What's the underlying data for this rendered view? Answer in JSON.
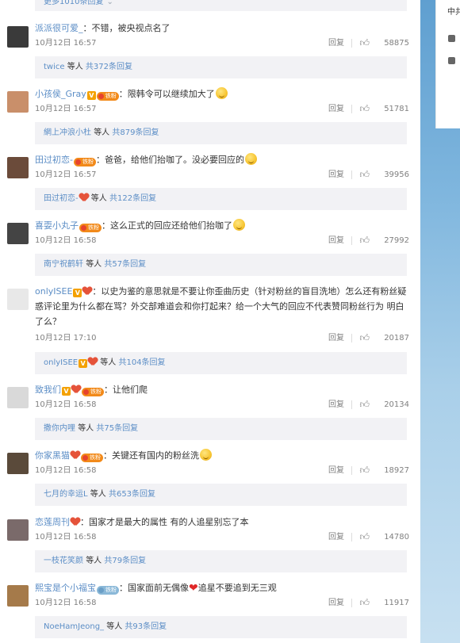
{
  "more_replies": "更多1010条回复",
  "right_panel": {
    "label": "中共"
  },
  "reply_label": "回复",
  "by_suffix": "等人",
  "comments": [
    {
      "user": "派派很可爱_",
      "text": "：不错，被央视点名了",
      "time": "10月12日 16:57",
      "likes": "58875",
      "sub_user": "twice",
      "sub_count": "共372条回复",
      "avatar": "#3a3a3a"
    },
    {
      "user": "小孩侯_Gray",
      "text": "：限韩令可以继续加大了",
      "time": "10月12日 16:57",
      "likes": "51781",
      "sub_user": "網上冲浪小杜",
      "sub_count": "共879条回复",
      "avatar": "#c98f6a"
    },
    {
      "user": "田过初恋-",
      "text": "：爸爸，给他们抬咖了。没必要回应的",
      "time": "10月12日 16:57",
      "likes": "39956",
      "sub_user": "田过初恋-",
      "sub_count": "共122条回复",
      "avatar": "#6b4b3a"
    },
    {
      "user": "喜耍小丸子",
      "text": "：这么正式的回应还给他们抬咖了",
      "time": "10月12日 16:58",
      "likes": "27992",
      "sub_user": "南宁祝鹤轩",
      "sub_count": "共57条回复",
      "avatar": "#444444"
    },
    {
      "user": "onlyISEE",
      "text": "：以史为鉴的意思就是不要让你歪曲历史（针对粉丝的盲目洗地）怎么还有粉丝疑惑评论里为什么都在骂？外交部难道会和你打起来？给一个大气的回应不代表赞同粉丝行为 明白了么？",
      "time": "10月12日 17:10",
      "likes": "20187",
      "sub_user": "onlyISEE",
      "sub_count": "共104条回复",
      "avatar": "#bbbbbb"
    },
    {
      "user": "致我们",
      "text": "：让他们爬",
      "time": "10月12日 16:58",
      "likes": "20134",
      "sub_user": "撒你内哩",
      "sub_count": "共75条回复",
      "avatar": "#d9d9d9"
    },
    {
      "user": "你家黑猫",
      "text": "：关键还有国内的粉丝洗",
      "time": "10月12日 16:58",
      "likes": "18927",
      "sub_user": "七月的幸运L",
      "sub_count": "共653条回复",
      "avatar": "#5a4a3a"
    },
    {
      "user": "恋莲周刊",
      "text": "：国家才是最大的属性 有的人追星别忘了本",
      "time": "10月12日 16:58",
      "likes": "14780",
      "sub_user": "一枝花笑颜",
      "sub_count": "共79条回复",
      "avatar": "#7a6a6a"
    },
    {
      "user": "熙宝是个小福宝",
      "text": "：国家面前无偶像",
      "text2": "追星不要追到无三观",
      "time": "10月12日 16:58",
      "likes": "11917",
      "sub_user": "NoeHamJeong_",
      "sub_count": "共93条回复",
      "avatar": "#a57a4a"
    }
  ],
  "colors": {
    "link": "#5c8ec6",
    "meta": "#808080",
    "subbar_bg": "#f2f2f5",
    "vip": "#f4a100",
    "fan_badge": "#f28a1a"
  }
}
